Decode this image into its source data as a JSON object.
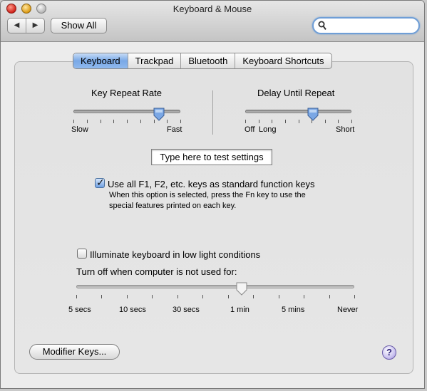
{
  "window": {
    "title": "Keyboard & Mouse"
  },
  "toolbar": {
    "back_glyph": "◀",
    "forward_glyph": "▶",
    "show_all_label": "Show All",
    "search_placeholder": ""
  },
  "tabs": [
    {
      "label": "Keyboard",
      "active": true
    },
    {
      "label": "Trackpad",
      "active": false
    },
    {
      "label": "Bluetooth",
      "active": false
    },
    {
      "label": "Keyboard Shortcuts",
      "active": false
    }
  ],
  "key_repeat": {
    "title": "Key Repeat Rate",
    "min_label": "Slow",
    "max_label": "Fast",
    "value_fraction": 0.8
  },
  "delay_repeat": {
    "title": "Delay Until Repeat",
    "off_label": "Off",
    "min_label": "Long",
    "max_label": "Short",
    "value_fraction": 0.64
  },
  "test_field": {
    "text": "Type here to test settings"
  },
  "fn_keys": {
    "label": "Use all F1, F2, etc. keys as standard function keys",
    "checked": true,
    "description_line1": "When this option is selected, press the Fn key to use the",
    "description_line2": "special features printed on each key."
  },
  "illuminate": {
    "label": "Illuminate keyboard in low light conditions",
    "checked": false
  },
  "turnoff": {
    "label": "Turn off when computer is not used for:",
    "value_label": "1 min",
    "ticks": [
      "5 secs",
      "10 secs",
      "30 secs",
      "1 min",
      "5 mins",
      "Never"
    ]
  },
  "buttons": {
    "modifier_keys": "Modifier Keys...",
    "help": "?"
  },
  "icons": {
    "close": "close-icon",
    "minimize": "minimize-icon",
    "zoom": "zoom-icon",
    "search": "search-icon",
    "help": "help-icon"
  },
  "colors": {
    "accent": "#79a8e6",
    "tab_active": "#8fb9ee",
    "close_red": "#d0221a",
    "minimize_yellow": "#dc9a14"
  }
}
